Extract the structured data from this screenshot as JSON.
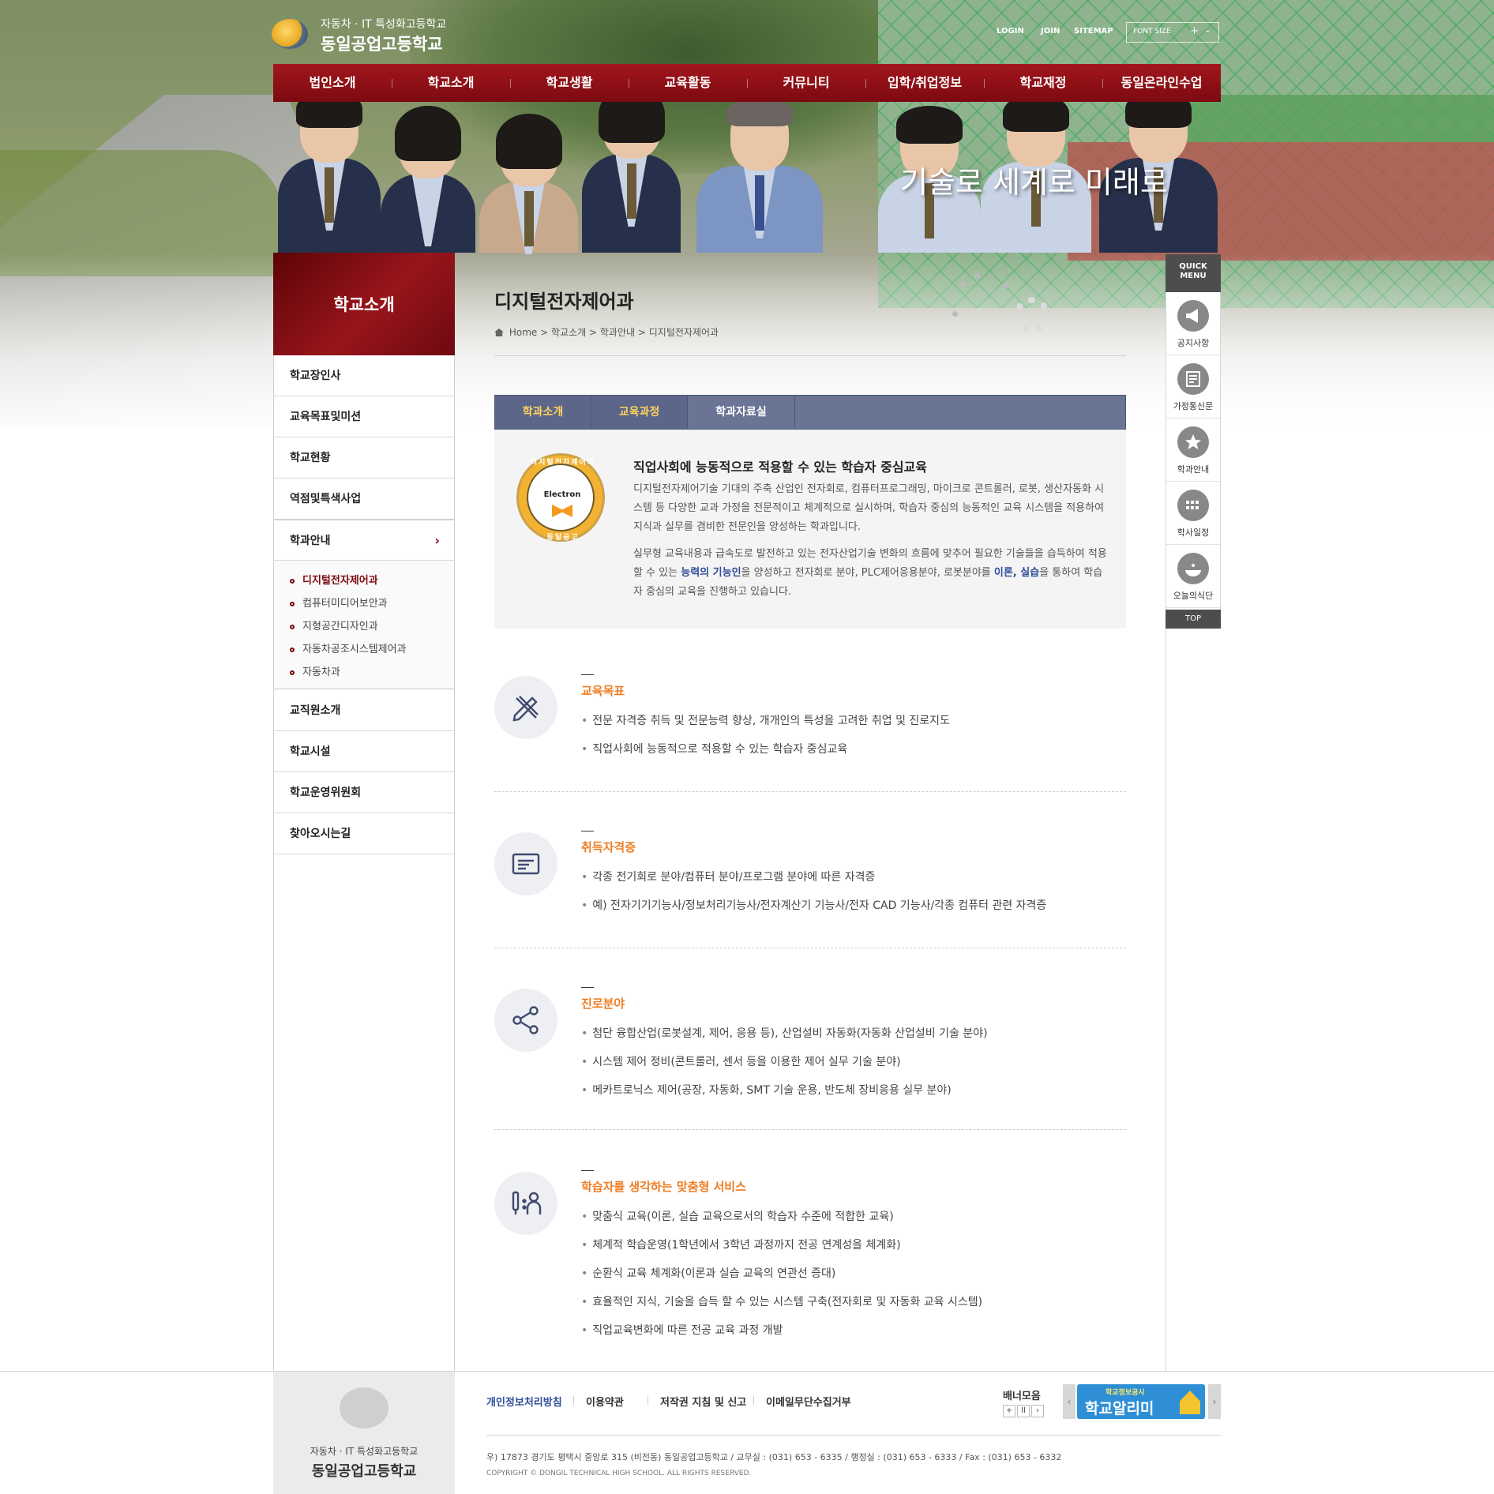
{
  "header": {
    "logo_sub": "자동차 · IT 특성화고등학교",
    "logo_main": "동일공업고등학교",
    "util_links": [
      "LOGIN",
      "JOIN",
      "SITEMAP"
    ],
    "font_size_label": "FONT SIZE",
    "font_size_controls": [
      "+",
      "-"
    ],
    "slogan": "기술로 세계로 미래로"
  },
  "gnb": [
    "법인소개",
    "학교소개",
    "학교생활",
    "교육활동",
    "커뮤니티",
    "입학/취업정보",
    "학교재정",
    "동일온라인수업"
  ],
  "sidebar": {
    "title": "학교소개",
    "items": [
      {
        "label": "학교장인사"
      },
      {
        "label": "교육목표및미션"
      },
      {
        "label": "학교현황"
      },
      {
        "label": "역점및특색사업"
      },
      {
        "label": "학과안내",
        "active": true
      },
      {
        "label": "교직원소개"
      },
      {
        "label": "학교시설"
      },
      {
        "label": "학교운영위원회"
      },
      {
        "label": "찾아오시는길"
      }
    ],
    "sub_items": [
      "디지털전자제어과",
      "컴퓨터미디어보안과",
      "지형공간디자인과",
      "자동차공조시스템제어과",
      "자동차과"
    ],
    "arrow": "›"
  },
  "page": {
    "title": "디지털전자제어과",
    "breadcrumb": [
      "Home",
      "학교소개",
      "학과안내",
      "디지털전자제어과"
    ],
    "breadcrumb_sep": ">"
  },
  "tabs": [
    {
      "label": "학과소개",
      "active": true
    },
    {
      "label": "교육과정",
      "active": true
    },
    {
      "label": "학과자료실",
      "active": false
    }
  ],
  "intro": {
    "badge_ring_top": "디지털전자제어과",
    "badge_center": "Electron",
    "badge_ring_bottom": "동일공고",
    "heading": "직업사회에 능동적으로 적용할 수 있는 학습자 중심교육",
    "paragraph1": "디지털전자제어기술 기대의 주축 산업인 전자회로, 컴퓨터프로그래밍, 마이크로 콘트롤러, 로봇, 생산자동화 시스템 등 다양한 교과 가정을 전문적이고 체계적으로 실시하며, 학습자 중심의 능동적인 교육 시스템을 적용하여 지식과 실무를 겸비한 전문인을 양성하는 학과입니다.",
    "paragraph2_a": "실무형 교육내용과 급속도로 발전하고 있는 전자산업기술 변화의 흐름에 맞추어 필요한 기술들을 습득하여 적용할 수 있는 ",
    "paragraph2_hl1": "능력의 기능인",
    "paragraph2_b": "을 양성하고 전자회로 분야, PLC제어응용분야, 로봇분야를 ",
    "paragraph2_hl2": "이론, 실습",
    "paragraph2_c": "을 통하여 학습자 중심의 교육을 진행하고 있습니다."
  },
  "sections": [
    {
      "title": "교육목표",
      "icon": "pencil-ruler-icon",
      "items": [
        "전문 자격증 취득 및 전문능력 향상, 개개인의 특성을 고려한 취업 및 진로지도",
        "직업사회에 능동적으로 적용할 수 있는 학습자 중심교육"
      ]
    },
    {
      "title": "취득자격증",
      "icon": "certificate-icon",
      "items": [
        "각종 전기회로 분야/컴퓨터 분야/프로그램 분야에 따른 자격증",
        "예) 전자기기기능사/정보처리기능사/전자계산기 기능사/전자 CAD 기능사/각종 컴퓨터 관련 자격증"
      ]
    },
    {
      "title": "진로분야",
      "icon": "share-icon",
      "items": [
        "첨단 융합산업(로봇설계, 제어, 응용 등), 산업설비 자동화(자동화 산업설비 기술 분야)",
        "시스템 제어 정비(콘트롤러, 센서 등을 이용한 제어 실무 기술 분야)",
        "메카트로닉스 제어(공장, 자동화, SMT 기술 운용, 반도체 장비응용 실무 분야)"
      ]
    },
    {
      "title": "학습자를 생각하는 맞춤형 서비스",
      "icon": "learner-icon",
      "items": [
        "맞춤식 교육(이론, 실습 교육으로서의 학습자 수준에 적합한 교육)",
        "체계적 학습운영(1학년에서 3학년 과정까지 전공 연계성을 체계화)",
        "순환식 교육 체계화(이론과 실습 교육의 연관선 증대)",
        "효율적인 지식, 기술을 습득 할 수 있는 시스템 구축(전자회로 및 자동화 교육 시스템)",
        "직업교육변화에 따른 전공 교육 과정 개발"
      ]
    }
  ],
  "quick_menu": {
    "title_line1": "QUICK",
    "title_line2": "MENU",
    "items": [
      {
        "label": "공지사항",
        "icon": "megaphone-icon"
      },
      {
        "label": "가정통신문",
        "icon": "newsletter-icon"
      },
      {
        "label": "학과안내",
        "icon": "star-icon"
      },
      {
        "label": "학사일정",
        "icon": "calendar-icon"
      },
      {
        "label": "오늘의식단",
        "icon": "meal-icon"
      }
    ],
    "top_label": "TOP"
  },
  "footer": {
    "logo_sub": "자동차 · IT 특성화고등학교",
    "logo_main": "동일공업고등학교",
    "links": [
      "개인정보처리방침",
      "이용약관",
      "저작권 지침 및 신고",
      "이메일무단수집거부"
    ],
    "address": "우) 17873 경기도 평택시 중앙로 315 (비전동) 동일공업고등학교 / 교무실 : (031) 653 - 6335 / 행정실 : (031) 653 - 6333 / Fax : (031) 653 - 6332",
    "copyright": "COPYRIGHT © DONGIL TECHNICAL HIGH SCHOOL. ALL RIGHTS RESERVED.",
    "banner_label": "배너모음",
    "banner_controls": [
      "+",
      "II",
      "›"
    ],
    "banner_small": "학교정보공시",
    "banner_main": "학교알리미",
    "banner_prev": "‹",
    "banner_next": "›"
  },
  "colors": {
    "brand_red": "#8a0f15",
    "tab_blue": "#6a7596",
    "accent_orange": "#ef7d22",
    "highlight_blue": "#2e4d9a"
  }
}
